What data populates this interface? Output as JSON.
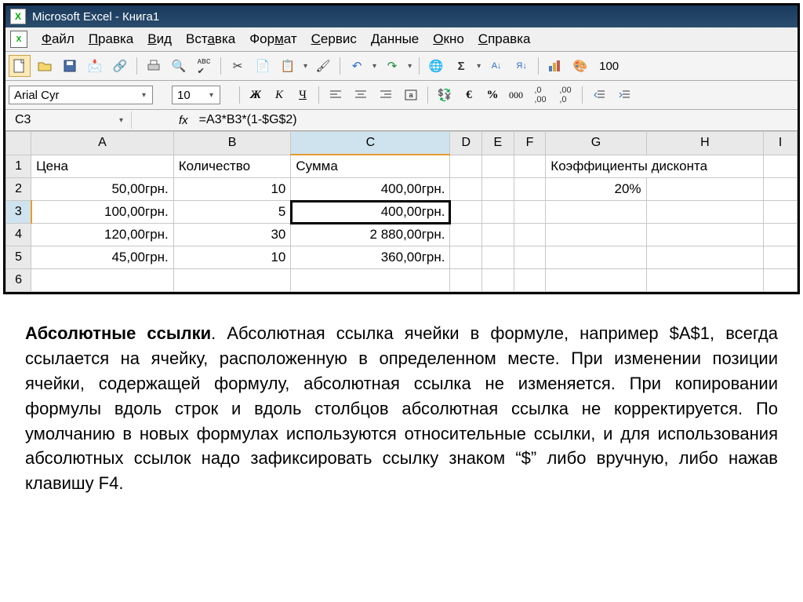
{
  "titlebar": {
    "title": "Microsoft Excel - Книга1"
  },
  "menu": {
    "items": [
      "Файл",
      "Правка",
      "Вид",
      "Вставка",
      "Формат",
      "Сервис",
      "Данные",
      "Окно",
      "Справка"
    ]
  },
  "toolbar": {
    "zoom": "100"
  },
  "format": {
    "font": "Arial Cyr",
    "size": "10",
    "bold": "Ж",
    "italic": "К",
    "underline": "Ч",
    "currency": "€",
    "percent": "%",
    "thousands": "000"
  },
  "formula": {
    "cell": "C3",
    "fx": "fx",
    "text": "=A3*B3*(1-$G$2)"
  },
  "columns": [
    "A",
    "B",
    "C",
    "D",
    "E",
    "F",
    "G",
    "H",
    "I"
  ],
  "rows": {
    "r1": {
      "A": "Цена",
      "B": "Количество",
      "C": "Сумма",
      "G": "Коэффициенты дисконта"
    },
    "r2": {
      "A": "50,00грн.",
      "B": "10",
      "C": "400,00грн.",
      "G": "20%"
    },
    "r3": {
      "A": "100,00грн.",
      "B": "5",
      "C": "400,00грн."
    },
    "r4": {
      "A": "120,00грн.",
      "B": "30",
      "C": "2 880,00грн."
    },
    "r5": {
      "A": "45,00грн.",
      "B": "10",
      "C": "360,00грн."
    }
  },
  "rowlabels": [
    "1",
    "2",
    "3",
    "4",
    "5",
    "6"
  ],
  "article": {
    "title": "Абсолютные ссылки",
    "body": ".    Абсолютная ссылка ячейки в формуле, например $A$1, всегда ссылается на ячейку, расположенную в определенном месте. При изменении позиции ячейки, содержащей формулу, абсолютная ссылка не изменяется. При копировании формулы вдоль строк и вдоль столбцов абсолютная ссылка не корректируется. По умолчанию в новых формулах используются относительные ссылки, и для использования абсолютных ссылок надо зафиксировать ссылку знаком “$” либо вручную, либо нажав клавишу F4."
  }
}
